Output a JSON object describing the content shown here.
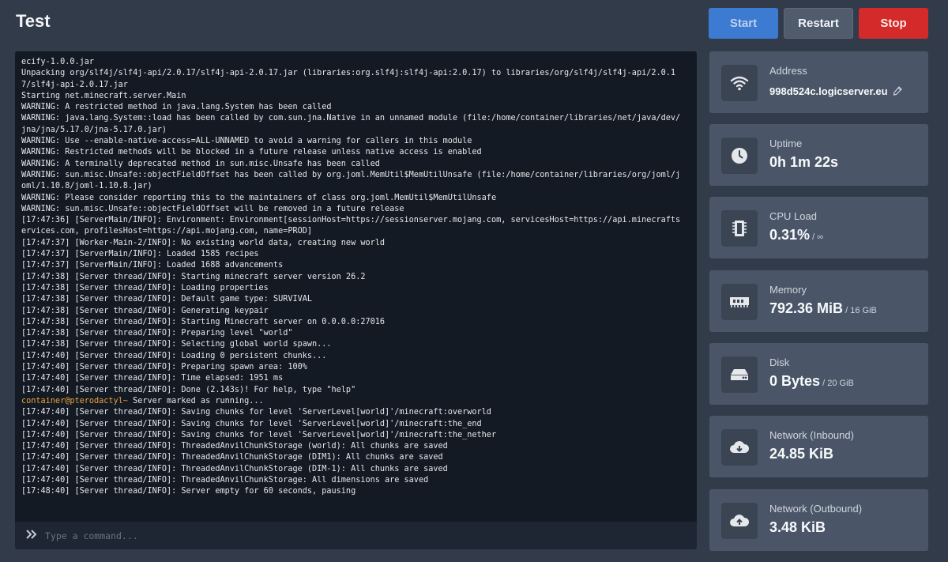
{
  "header": {
    "title": "Test",
    "start_label": "Start",
    "restart_label": "Restart",
    "stop_label": "Stop"
  },
  "colors": {
    "start": "#3d7ad1",
    "restart": "#505b6b",
    "stop": "#d42a2a",
    "console_bg": "#141a24",
    "prompt": "#e8a33b"
  },
  "console": {
    "lines": [
      "ecify-1.0.0.jar",
      "Unpacking org/slf4j/slf4j-api/2.0.17/slf4j-api-2.0.17.jar (libraries:org.slf4j:slf4j-api:2.0.17) to libraries/org/slf4j/slf4j-api/2.0.17/slf4j-api-2.0.17.jar",
      "Starting net.minecraft.server.Main",
      "WARNING: A restricted method in java.lang.System has been called",
      "WARNING: java.lang.System::load has been called by com.sun.jna.Native in an unnamed module (file:/home/container/libraries/net/java/dev/jna/jna/5.17.0/jna-5.17.0.jar)",
      "WARNING: Use --enable-native-access=ALL-UNNAMED to avoid a warning for callers in this module",
      "WARNING: Restricted methods will be blocked in a future release unless native access is enabled",
      "WARNING: A terminally deprecated method in sun.misc.Unsafe has been called",
      "WARNING: sun.misc.Unsafe::objectFieldOffset has been called by org.joml.MemUtil$MemUtilUnsafe (file:/home/container/libraries/org/joml/joml/1.10.8/joml-1.10.8.jar)",
      "WARNING: Please consider reporting this to the maintainers of class org.joml.MemUtil$MemUtilUnsafe",
      "WARNING: sun.misc.Unsafe::objectFieldOffset will be removed in a future release",
      "[17:47:36] [ServerMain/INFO]: Environment: Environment[sessionHost=https://sessionserver.mojang.com, servicesHost=https://api.minecraftservices.com, profilesHost=https://api.mojang.com, name=PROD]",
      "[17:47:37] [Worker-Main-2/INFO]: No existing world data, creating new world",
      "[17:47:37] [ServerMain/INFO]: Loaded 1585 recipes",
      "[17:47:37] [ServerMain/INFO]: Loaded 1688 advancements",
      "[17:47:38] [Server thread/INFO]: Starting minecraft server version 26.2",
      "[17:47:38] [Server thread/INFO]: Loading properties",
      "[17:47:38] [Server thread/INFO]: Default game type: SURVIVAL",
      "[17:47:38] [Server thread/INFO]: Generating keypair",
      "[17:47:38] [Server thread/INFO]: Starting Minecraft server on 0.0.0.0:27016",
      "[17:47:38] [Server thread/INFO]: Preparing level \"world\"",
      "[17:47:38] [Server thread/INFO]: Selecting global world spawn...",
      "[17:47:40] [Server thread/INFO]: Loading 0 persistent chunks...",
      "[17:47:40] [Server thread/INFO]: Preparing spawn area: 100%",
      "[17:47:40] [Server thread/INFO]: Time elapsed: 1951 ms",
      "[17:47:40] [Server thread/INFO]: Done (2.143s)! For help, type \"help\""
    ],
    "prompt": "container@pterodactyl~",
    "prompt_message": " Server marked as running...",
    "lines_after": [
      "[17:47:40] [Server thread/INFO]: Saving chunks for level 'ServerLevel[world]'/minecraft:overworld",
      "[17:47:40] [Server thread/INFO]: Saving chunks for level 'ServerLevel[world]'/minecraft:the_end",
      "[17:47:40] [Server thread/INFO]: Saving chunks for level 'ServerLevel[world]'/minecraft:the_nether",
      "[17:47:40] [Server thread/INFO]: ThreadedAnvilChunkStorage (world): All chunks are saved",
      "[17:47:40] [Server thread/INFO]: ThreadedAnvilChunkStorage (DIM1): All chunks are saved",
      "[17:47:40] [Server thread/INFO]: ThreadedAnvilChunkStorage (DIM-1): All chunks are saved",
      "[17:47:40] [Server thread/INFO]: ThreadedAnvilChunkStorage: All dimensions are saved",
      "[17:48:40] [Server thread/INFO]: Server empty for 60 seconds, pausing"
    ],
    "input_placeholder": "Type a command..."
  },
  "stats": {
    "address": {
      "label": "Address",
      "value": "998d524c.logicserver.eu",
      "icon": "wifi-icon"
    },
    "uptime": {
      "label": "Uptime",
      "value": "0h 1m 22s",
      "icon": "clock-icon"
    },
    "cpu": {
      "label": "CPU Load",
      "value": "0.31%",
      "suffix": " / ∞",
      "icon": "cpu-icon"
    },
    "memory": {
      "label": "Memory",
      "value": "792.36 MiB",
      "suffix": " / 16 GiB",
      "icon": "memory-icon"
    },
    "disk": {
      "label": "Disk",
      "value": "0 Bytes",
      "suffix": " / 20 GiB",
      "icon": "disk-icon"
    },
    "net_in": {
      "label": "Network (Inbound)",
      "value": "24.85 KiB",
      "icon": "cloud-download-icon"
    },
    "net_out": {
      "label": "Network (Outbound)",
      "value": "3.48 KiB",
      "icon": "cloud-upload-icon"
    }
  }
}
